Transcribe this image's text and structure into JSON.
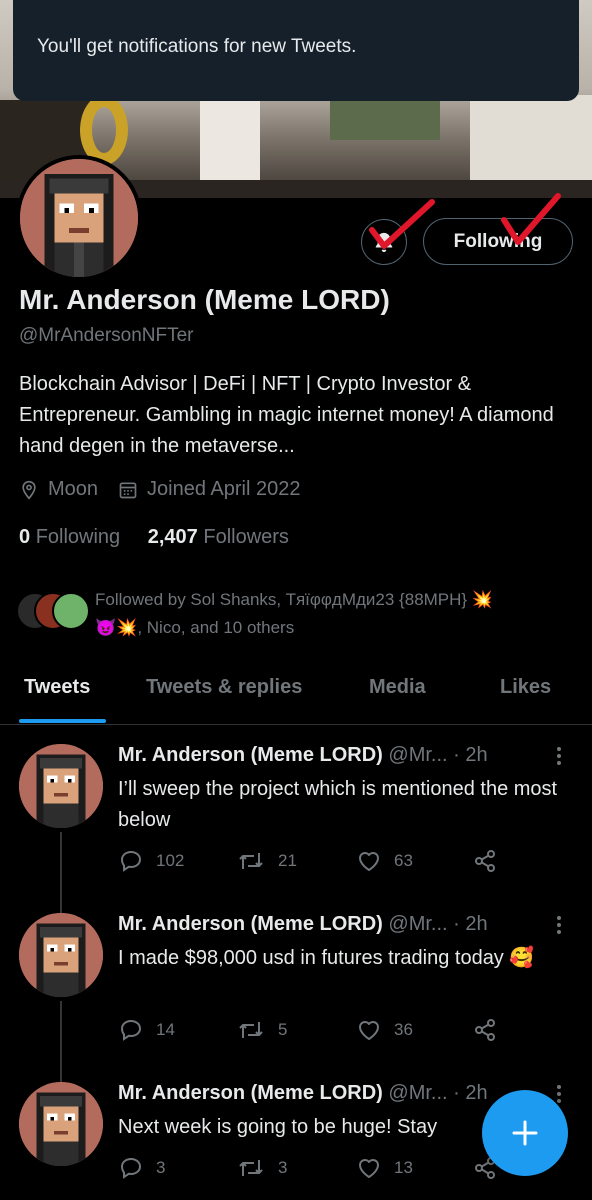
{
  "toast": {
    "message": "You'll get notifications for new Tweets."
  },
  "profile": {
    "follow_button": "Following",
    "name": "Mr. Anderson (Meme LORD)",
    "handle": "@MrAndersonNFTer",
    "bio": "Blockchain Advisor | DeFi | NFT | Crypto Investor & Entrepreneur.  Gambling in magic internet money! A diamond hand degen in the metaverse...",
    "location": "Moon",
    "joined": "Joined April 2022",
    "following_count": "0",
    "following_label": "Following",
    "followers_count": "2,407",
    "followers_label": "Followers",
    "followed_by_line1": "Followed by Sol Shanks, TяїφφдМди23 {88MPH} 💥",
    "followed_by_line2": "😈💥, Nico, and 10 others",
    "annotation_color": "#e0162b"
  },
  "tabs": [
    {
      "label": "Tweets",
      "active": true
    },
    {
      "label": "Tweets & replies"
    },
    {
      "label": "Media"
    },
    {
      "label": "Likes"
    }
  ],
  "tweets": [
    {
      "name": "Mr. Anderson (Meme LORD)",
      "handle_time": "@Mr...  · 2h",
      "text": "I’ll sweep the project which is mentioned the most below",
      "replies": "102",
      "retweets": "21",
      "likes": "63"
    },
    {
      "name": "Mr. Anderson (Meme LORD)",
      "handle_time": "@Mr...  · 2h",
      "text": "I made $98,000 usd in futures trading today 🥰",
      "replies": "14",
      "retweets": "5",
      "likes": "36"
    },
    {
      "name": "Mr. Anderson (Meme LORD)",
      "handle_time": "@Mr...  · 2h",
      "text": "Next week is going to be huge! Stay",
      "replies": "3",
      "retweets": "3",
      "likes": "13"
    }
  ],
  "colors": {
    "accent": "#1d9bf0",
    "background": "#000000",
    "toast_bg": "#15202b"
  }
}
